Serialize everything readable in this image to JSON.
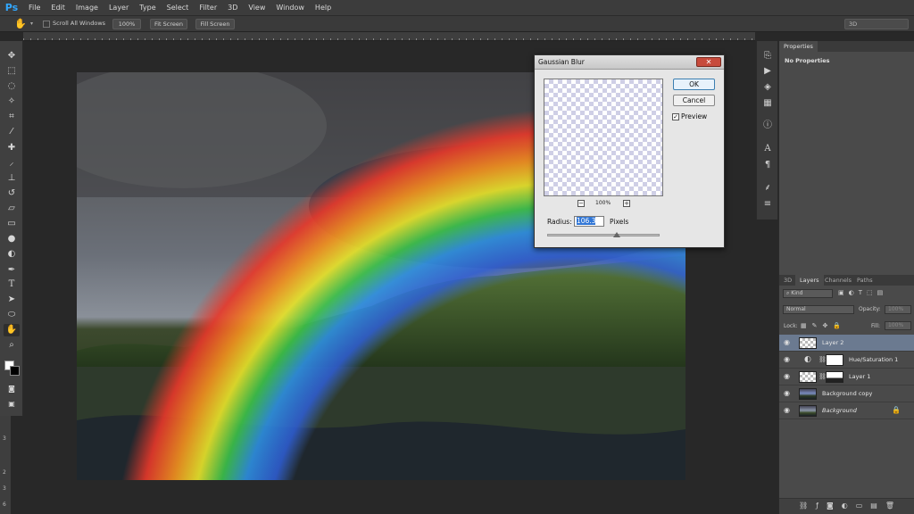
{
  "app": {
    "logo": "Ps",
    "accent": "#31a8ff"
  },
  "menu": [
    "File",
    "Edit",
    "Image",
    "Layer",
    "Type",
    "Select",
    "Filter",
    "3D",
    "View",
    "Window",
    "Help"
  ],
  "options": {
    "scroll_all_label": "Scroll All Windows",
    "zoom_100_label": "100%",
    "fit_screen_label": "Fit Screen",
    "fill_screen_label": "Fill Screen",
    "workspace": "3D"
  },
  "toolbar_icons": [
    "move-icon",
    "marquee-icon",
    "lasso-icon",
    "magic-wand-icon",
    "crop-icon",
    "eyedropper-icon",
    "healing-brush-icon",
    "brush-icon",
    "clone-stamp-icon",
    "history-brush-icon",
    "eraser-icon",
    "gradient-icon",
    "blur-icon",
    "dodge-icon",
    "pen-icon",
    "type-icon",
    "path-selection-icon",
    "shape-icon",
    "hand-icon",
    "zoom-icon"
  ],
  "ruler_left_numbers": [
    "3",
    "2",
    "3",
    "6"
  ],
  "properties": {
    "tab": "Properties",
    "empty_text": "No Properties"
  },
  "layers_panel": {
    "tabs": [
      "3D",
      "Layers",
      "Channels",
      "Paths"
    ],
    "active_tab": "Layers",
    "filter_label": "Kind",
    "blend_mode": "Normal",
    "opacity_label": "Opacity:",
    "opacity_value": "100%",
    "lock_label": "Lock:",
    "fill_label": "Fill:",
    "fill_value": "100%",
    "layers": [
      {
        "name": "Layer 2",
        "selected": true
      },
      {
        "name": "Hue/Saturation 1",
        "selected": false
      },
      {
        "name": "Layer 1",
        "selected": false
      },
      {
        "name": "Background copy",
        "selected": false
      },
      {
        "name": "Background",
        "selected": false,
        "locked": true
      }
    ]
  },
  "dialog": {
    "title": "Gaussian Blur",
    "ok_label": "OK",
    "cancel_label": "Cancel",
    "preview_label": "Preview",
    "preview_checked": true,
    "zoom_level": "100%",
    "radius_label": "Radius:",
    "radius_value": "106.3",
    "radius_unit": "Pixels",
    "slider_fraction": 0.62
  }
}
